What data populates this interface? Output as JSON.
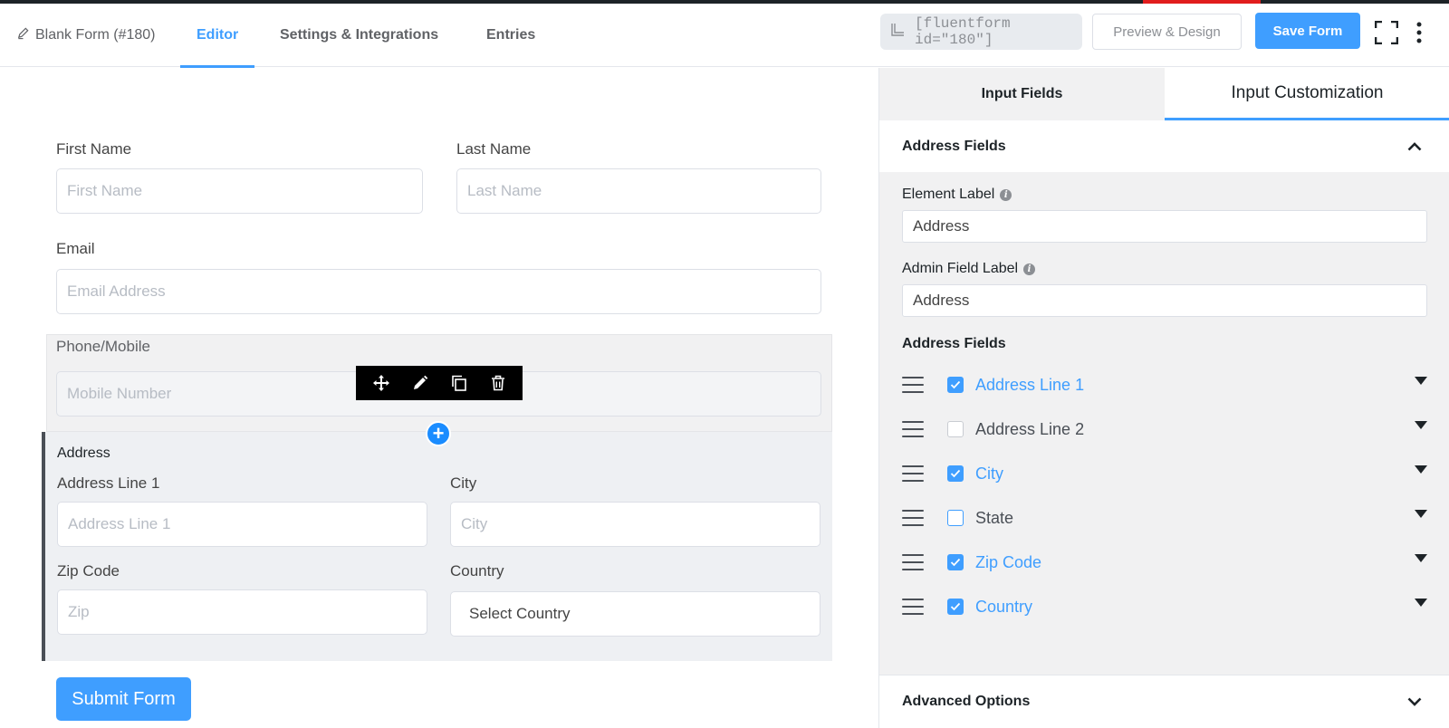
{
  "header": {
    "form_title": "Blank Form (#180)",
    "tabs": [
      {
        "label": "Editor",
        "active": true
      },
      {
        "label": "Settings & Integrations",
        "active": false
      },
      {
        "label": "Entries",
        "active": false
      }
    ],
    "shortcode": "[fluentform id=\"180\"]",
    "preview_label": "Preview & Design",
    "save_label": "Save Form",
    "icons": [
      "pencil-icon",
      "copy-shortcode-icon",
      "fullscreen-icon",
      "kebab-menu-icon"
    ]
  },
  "form": {
    "first_name": {
      "label": "First Name",
      "placeholder": "First Name"
    },
    "last_name": {
      "label": "Last Name",
      "placeholder": "Last Name"
    },
    "email": {
      "label": "Email",
      "placeholder": "Email Address"
    },
    "phone": {
      "label": "Phone/Mobile",
      "placeholder": "Mobile Number"
    },
    "toolbar_icons": [
      "move-icon",
      "edit-icon",
      "duplicate-icon",
      "delete-icon"
    ],
    "address": {
      "title": "Address",
      "line1": {
        "label": "Address Line 1",
        "placeholder": "Address Line 1"
      },
      "city": {
        "label": "City",
        "placeholder": "City"
      },
      "zip": {
        "label": "Zip Code",
        "placeholder": "Zip"
      },
      "country": {
        "label": "Country",
        "value": "Select Country"
      }
    },
    "submit_label": "Submit Form"
  },
  "sidebar": {
    "tabs": [
      {
        "label": "Input Fields",
        "active": false
      },
      {
        "label": "Input Customization",
        "active": true
      }
    ],
    "section_title": "Address Fields",
    "element_label": {
      "label": "Element Label",
      "value": "Address"
    },
    "admin_label": {
      "label": "Admin Field Label",
      "value": "Address"
    },
    "fields_title": "Address Fields",
    "fields": [
      {
        "label": "Address Line 1",
        "checked": true
      },
      {
        "label": "Address Line 2",
        "checked": false
      },
      {
        "label": "City",
        "checked": true
      },
      {
        "label": "State",
        "checked": false
      },
      {
        "label": "Zip Code",
        "checked": true
      },
      {
        "label": "Country",
        "checked": true
      }
    ],
    "advanced_title": "Advanced Options"
  },
  "colors": {
    "accent": "#3f9eff",
    "top_strip": "#1d2327",
    "top_strip_highlight": "#e11d1d"
  }
}
